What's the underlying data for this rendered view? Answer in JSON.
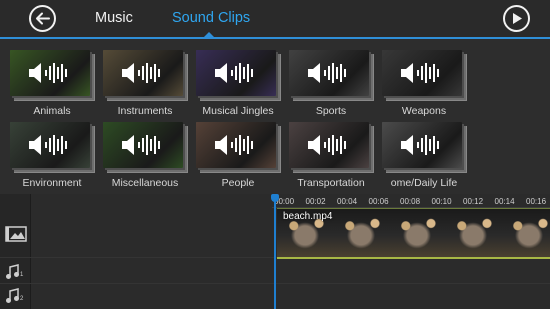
{
  "header": {
    "tabs": [
      {
        "label": "Music",
        "active": false
      },
      {
        "label": "Sound Clips",
        "active": true
      }
    ],
    "accent_color": "#2fa6f0"
  },
  "clips": [
    {
      "label": "Animals",
      "color": "#5a8a3a"
    },
    {
      "label": "Instruments",
      "color": "#8a7a5a"
    },
    {
      "label": "Musical Jingles",
      "color": "#5a4a8a"
    },
    {
      "label": "Sports",
      "color": "#6a6a6a"
    },
    {
      "label": "Weapons",
      "color": "#5a5a5a"
    },
    {
      "label": "Environment",
      "color": "#5a6a5a"
    },
    {
      "label": "Miscellaneous",
      "color": "#4a7a3a"
    },
    {
      "label": "People",
      "color": "#8a6a5a"
    },
    {
      "label": "Transportation",
      "color": "#7a6a6a"
    },
    {
      "label": "ome/Daily Life",
      "color": "#7a7a7a"
    }
  ],
  "timeline": {
    "ticks": [
      "00:00",
      "00:02",
      "00:04",
      "00:06",
      "00:08",
      "00:10",
      "00:12",
      "00:14",
      "00:16"
    ],
    "clip_name": "beach.mp4",
    "audio_track_numbers": [
      "1",
      "2"
    ]
  }
}
